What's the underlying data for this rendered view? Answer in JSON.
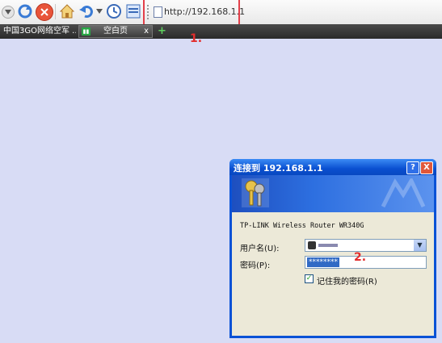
{
  "toolbar": {
    "icons": [
      "dropdown-icon",
      "refresh-icon",
      "stop-icon",
      "home-icon",
      "undo-icon",
      "history-icon",
      "favorites-icon"
    ],
    "address": "http://192.168.1.1"
  },
  "tabs": {
    "tab1_label": "中国3GO网络空军 ...",
    "tab2_label": "空白页",
    "tab2_close": "x",
    "new_tab": "+"
  },
  "annotations": {
    "step1": "1.",
    "step2": "2."
  },
  "dialog": {
    "title": "连接到 192.168.1.1",
    "help": "?",
    "close": "X",
    "router_name": "TP-LINK Wireless Router WR340G",
    "username_label": "用户名(U):",
    "password_label": "密码(P):",
    "password_mask": "********",
    "remember_label": "记住我的密码(R)",
    "remember_checked": true,
    "dropdown_arrow": "▼"
  },
  "colors": {
    "annotation": "#e32d2d",
    "title_bar": "#0a52d6",
    "desktop": "#d8dcf5"
  }
}
